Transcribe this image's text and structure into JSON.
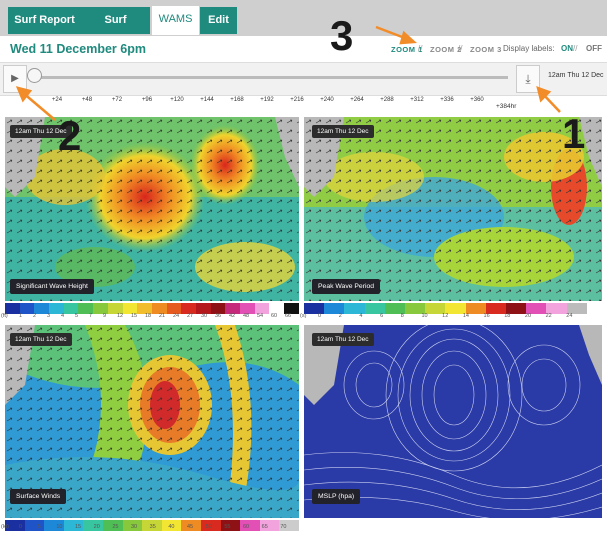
{
  "tabs": [
    {
      "label": "Surf Report"
    },
    {
      "label": "Surf Forecast"
    },
    {
      "label": "WAMS"
    },
    {
      "label": "Edit"
    }
  ],
  "header": {
    "date": "Wed 11 December 6pm",
    "zoom1": "ZOOM 1",
    "zoom2": "ZOOM 2",
    "zoom3": "ZOOM 3",
    "sep": "//",
    "display_labels": "Display labels:",
    "on": "ON",
    "slash": "//",
    "off": "OFF"
  },
  "timeline": {
    "play_icon": "play-icon",
    "download_icon": "download-icon",
    "current_time": "12am Thu 12 Dec",
    "ticks": [
      "+24",
      "+48",
      "+72",
      "+96",
      "+120",
      "+144",
      "+168",
      "+192",
      "+216",
      "+240",
      "+264",
      "+288",
      "+312",
      "+336",
      "+360"
    ],
    "end_tick": "+384hr",
    "progress": 0
  },
  "panels": {
    "wave_height": {
      "time": "12am Thu 12 Dec",
      "label": "Significant Wave Height"
    },
    "wave_period": {
      "time": "12am Thu 12 Dec",
      "label": "Peak Wave Period"
    },
    "winds": {
      "time": "12am Thu 12 Dec",
      "label": "Surface Winds"
    },
    "mslp": {
      "time": "12am Thu 12 Dec",
      "label": "MSLP (hpa)"
    }
  },
  "scales": {
    "height_unit": "(ft)",
    "height": [
      "1",
      "2",
      "3",
      "4",
      "5",
      "7",
      "9",
      "12",
      "15",
      "18",
      "21",
      "24",
      "27",
      "30",
      "36",
      "42",
      "48",
      "54",
      "60",
      "66"
    ],
    "period_unit": "(s)",
    "period": [
      "0",
      "2",
      "4",
      "6",
      "8",
      "10",
      "12",
      "14",
      "16",
      "18",
      "20",
      "22",
      "24"
    ],
    "wind_unit": "(kt)",
    "wind": [
      "0",
      "5",
      "10",
      "15",
      "20",
      "25",
      "30",
      "35",
      "40",
      "45",
      "50",
      "55",
      "60",
      "65",
      "70"
    ]
  },
  "annotations": [
    "1",
    "2",
    "3"
  ],
  "colors": {
    "accent": "#1f8a7e",
    "callout_arrow": "#f28c28"
  }
}
